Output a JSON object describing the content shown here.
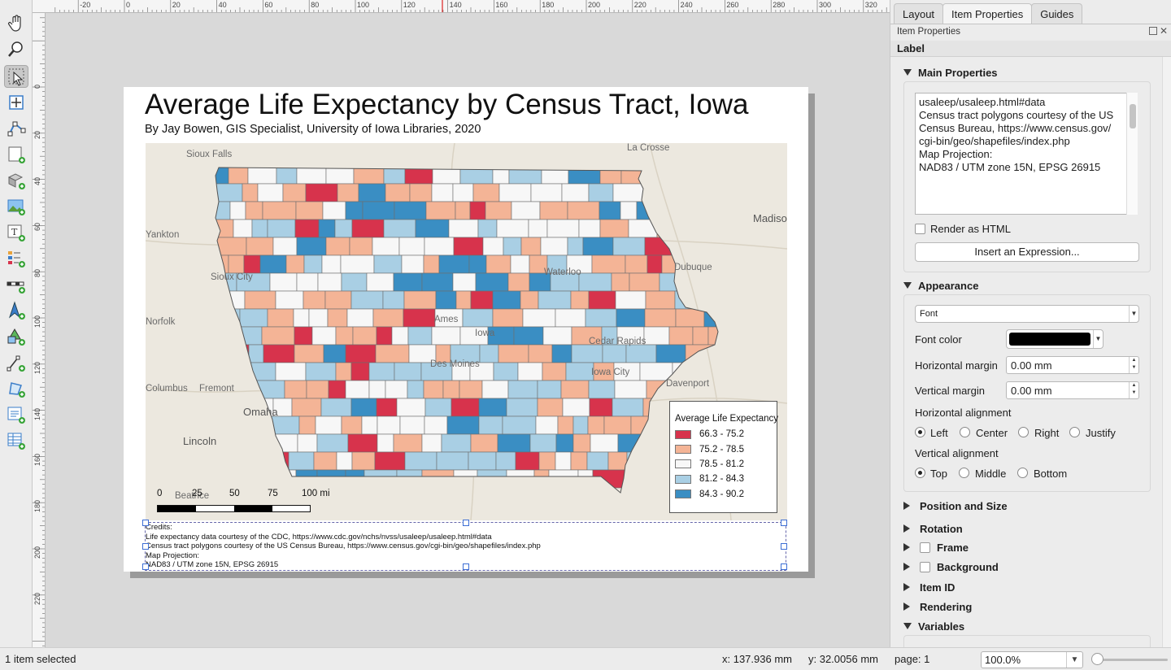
{
  "toolbar": {
    "icons": [
      "pan-icon",
      "zoom-icon",
      "select-icon",
      "move-content-icon",
      "edit-nodes-icon",
      "add-map-icon",
      "add-3d-map-icon",
      "add-picture-icon",
      "add-label-icon",
      "add-legend-icon",
      "add-scalebar-icon",
      "add-north-arrow-icon",
      "add-shape-icon",
      "add-polyline-icon",
      "add-polygon-icon",
      "add-html-icon",
      "add-attribute-table-icon"
    ]
  },
  "ruler": {
    "top_labels": [
      "-20",
      "0",
      "20",
      "40",
      "60",
      "80",
      "100",
      "120",
      "140",
      "160",
      "180",
      "200",
      "220",
      "240",
      "260",
      "280",
      "300",
      "320"
    ],
    "left_labels": [
      "0",
      "20",
      "40",
      "60",
      "80",
      "100",
      "120",
      "140",
      "160",
      "180",
      "200",
      "220"
    ]
  },
  "layout": {
    "title": "Average Life Expectancy by Census Tract, Iowa",
    "subtitle": "By Jay Bowen, GIS Specialist, University of Iowa Libraries, 2020",
    "map_places": [
      {
        "name": "Sioux Falls",
        "size": "sm"
      },
      {
        "name": "La Crosse",
        "size": "sm"
      },
      {
        "name": "Madison",
        "size": "lg"
      },
      {
        "name": "Yankton",
        "size": "sm"
      },
      {
        "name": "Sioux City",
        "size": "sm"
      },
      {
        "name": "Dubuque",
        "size": "sm"
      },
      {
        "name": "Norfolk",
        "size": "sm"
      },
      {
        "name": "Waterloo",
        "size": "sm"
      },
      {
        "name": "Iowa",
        "size": "sm"
      },
      {
        "name": "Ames",
        "size": "sm"
      },
      {
        "name": "Cedar Rapids",
        "size": "sm"
      },
      {
        "name": "Iowa City",
        "size": "sm"
      },
      {
        "name": "Des Moines",
        "size": "sm"
      },
      {
        "name": "Davenport",
        "size": "sm"
      },
      {
        "name": "Columbus",
        "size": "sm"
      },
      {
        "name": "Fremont",
        "size": "sm"
      },
      {
        "name": "Omaha",
        "size": "lg"
      },
      {
        "name": "Lincoln",
        "size": "lg"
      },
      {
        "name": "Beatrice",
        "size": "sm"
      }
    ],
    "legend": {
      "title": "Average Life Expectancy",
      "classes": [
        {
          "label": "66.3 - 75.2",
          "color": "#d7334c"
        },
        {
          "label": "75.2 - 78.5",
          "color": "#f4b496"
        },
        {
          "label": "78.5 - 81.2",
          "color": "#f7f7f7"
        },
        {
          "label": "81.2 - 84.3",
          "color": "#a9cfe4"
        },
        {
          "label": "84.3 - 90.2",
          "color": "#3a8ec3"
        }
      ]
    },
    "scalebar": {
      "labels": [
        "0",
        "25",
        "50",
        "75",
        "100 mi"
      ]
    },
    "credits": [
      "Credits:",
      "Life expectancy data courtesy of the CDC, https://www.cdc.gov/nchs/nvss/usaleep/usaleep.html#data",
      "Census tract polygons courtesy of the US Census Bureau, https://www.census.gov/cgi-bin/geo/shapefiles/index.php",
      "Map Projection:",
      "NAD83 / UTM zone 15N, EPSG 26915"
    ]
  },
  "status": {
    "message": "1 item selected",
    "x_coord": "x: 137.936 mm",
    "y_coord": "y: 32.0056 mm",
    "page": "page: 1",
    "zoom": "100.0%"
  },
  "panel": {
    "tabs": [
      "Layout",
      "Item Properties",
      "Guides"
    ],
    "active_tab": "Item Properties",
    "title": "Item Properties",
    "item_type": "Label",
    "main_properties": {
      "header": "Main Properties",
      "text_lines": [
        "usaleep/usaleep.html#data",
        "Census tract polygons courtesy of the US",
        "Census Bureau, https://www.census.gov/",
        "cgi-bin/geo/shapefiles/index.php",
        "Map Projection:",
        "NAD83 / UTM zone 15N, EPSG 26915"
      ],
      "render_html_label": "Render as HTML",
      "insert_expression_label": "Insert an Expression..."
    },
    "appearance": {
      "header": "Appearance",
      "font_label": "Font",
      "font_color_label": "Font color",
      "font_color": "#000000",
      "h_margin_label": "Horizontal margin",
      "h_margin_value": "0.00 mm",
      "v_margin_label": "Vertical margin",
      "v_margin_value": "0.00 mm",
      "h_align_label": "Horizontal alignment",
      "h_align_options": [
        "Left",
        "Center",
        "Right",
        "Justify"
      ],
      "h_align_selected": "Left",
      "v_align_label": "Vertical alignment",
      "v_align_options": [
        "Top",
        "Middle",
        "Bottom"
      ],
      "v_align_selected": "Top"
    },
    "collapsed_sections": [
      "Position and Size",
      "Rotation",
      "Frame",
      "Background",
      "Item ID",
      "Rendering"
    ],
    "variables_header": "Variables"
  }
}
